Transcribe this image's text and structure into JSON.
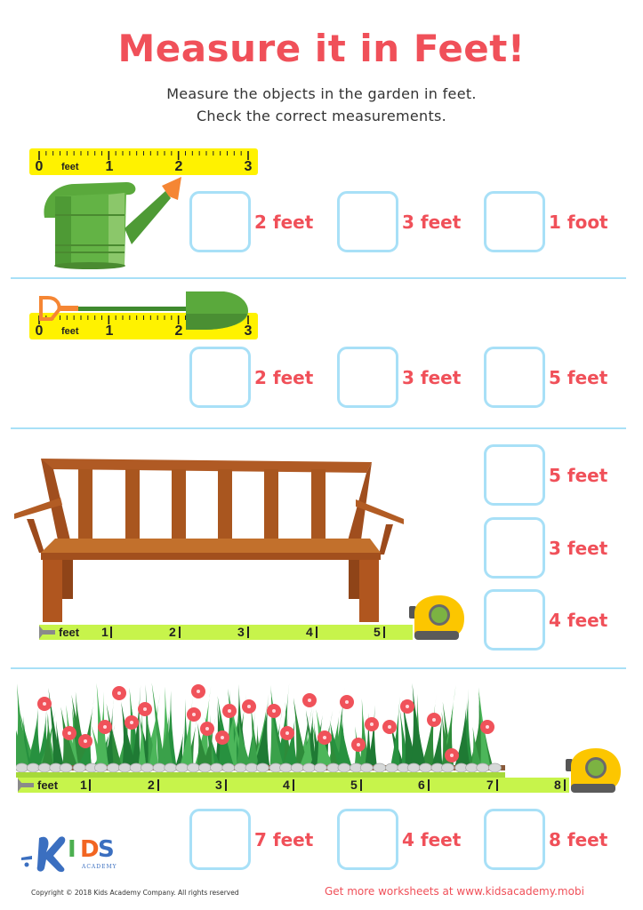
{
  "header": {
    "title": "Measure it in Feet!",
    "instructions": [
      "Measure the objects in the garden in feet.",
      "Check the correct measurements."
    ]
  },
  "colors": {
    "title_red": "#f05059",
    "box_border_blue": "#a8e0f7",
    "ruler_yellow": "#fff200",
    "tape_green": "#c7f44b",
    "tape_case_yellow": "#fcc600"
  },
  "exercises": [
    {
      "object": "watering can",
      "object_icon": "watering-can-icon",
      "measuring_tool": "ruler",
      "ruler": {
        "unit": "feet",
        "ticks": [
          "0",
          "1",
          "2",
          "3"
        ]
      },
      "options": [
        {
          "label": "2 feet",
          "checked": false
        },
        {
          "label": "3 feet",
          "checked": false
        },
        {
          "label": "1 foot",
          "checked": false
        }
      ]
    },
    {
      "object": "shovel",
      "object_icon": "shovel-icon",
      "measuring_tool": "ruler",
      "ruler": {
        "unit": "feet",
        "ticks": [
          "0",
          "1",
          "2",
          "3"
        ]
      },
      "options": [
        {
          "label": "2 feet",
          "checked": false
        },
        {
          "label": "3 feet",
          "checked": false
        },
        {
          "label": "5 feet",
          "checked": false
        }
      ]
    },
    {
      "object": "bench",
      "object_icon": "bench-icon",
      "measuring_tool": "tape measure",
      "tape": {
        "unit": "feet",
        "ticks": [
          "1",
          "2",
          "3",
          "4",
          "5"
        ]
      },
      "options": [
        {
          "label": "5 feet",
          "checked": false
        },
        {
          "label": "3 feet",
          "checked": false
        },
        {
          "label": "4 feet",
          "checked": false
        }
      ]
    },
    {
      "object": "flower bed",
      "object_icon": "flower-bed-icon",
      "measuring_tool": "tape measure",
      "tape": {
        "unit": "feet",
        "ticks": [
          "1",
          "2",
          "3",
          "4",
          "5",
          "6",
          "7",
          "8"
        ]
      },
      "options": [
        {
          "label": "7 feet",
          "checked": false
        },
        {
          "label": "4 feet",
          "checked": false
        },
        {
          "label": "8 feet",
          "checked": false
        }
      ]
    }
  ],
  "footer": {
    "logo": {
      "letters": [
        "K",
        "I",
        "D",
        "S"
      ],
      "subtitle": "ACADEMY"
    },
    "copyright": "Copyright © 2018 Kids Academy Company. All rights reserved",
    "promo": "Get more worksheets at www.kidsacademy.mobi"
  }
}
